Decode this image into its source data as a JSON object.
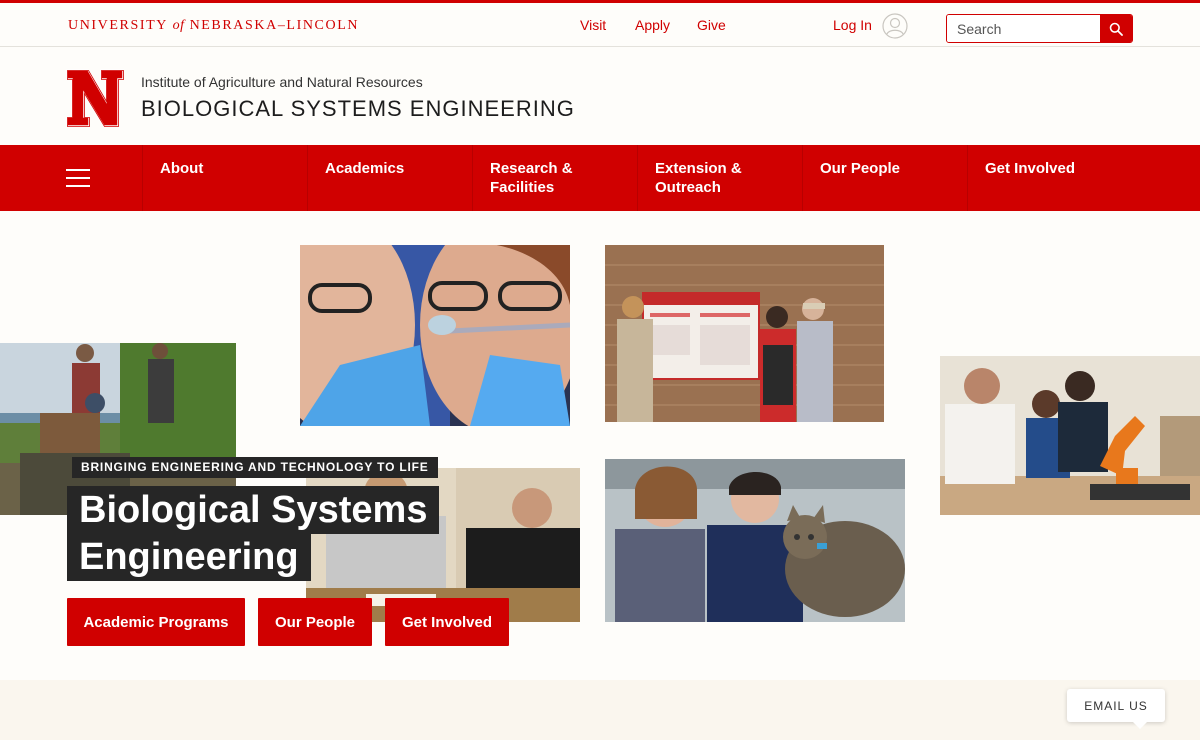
{
  "topbar": {
    "uni_name_pre": "University ",
    "uni_name_of": "of",
    "uni_name_post": " Nebraska–Lincoln",
    "links": [
      "Visit",
      "Apply",
      "Give"
    ],
    "login_label": "Log In",
    "search_placeholder": "Search"
  },
  "header": {
    "subtitle": "Institute of Agriculture and Natural Resources",
    "title": "BIOLOGICAL SYSTEMS ENGINEERING"
  },
  "nav": {
    "items": [
      {
        "line1": "About",
        "line2": ""
      },
      {
        "line1": "Academics",
        "line2": ""
      },
      {
        "line1": "Research &",
        "line2": "Facilities"
      },
      {
        "line1": "Extension &",
        "line2": "Outreach"
      },
      {
        "line1": "Our People",
        "line2": ""
      },
      {
        "line1": "Get Involved",
        "line2": ""
      }
    ]
  },
  "hero": {
    "kicker": "Bringing Engineering and Technology to Life",
    "title_line1": "Biological Systems",
    "title_line2": "Engineering",
    "buttons": [
      "Academic Programs",
      "Our People",
      "Get Involved"
    ]
  },
  "chat": {
    "email_label": "EMAIL US"
  },
  "colors": {
    "brand_red": "#d00000",
    "dark_overlay": "#262626",
    "page_bg": "#fefdfa"
  }
}
